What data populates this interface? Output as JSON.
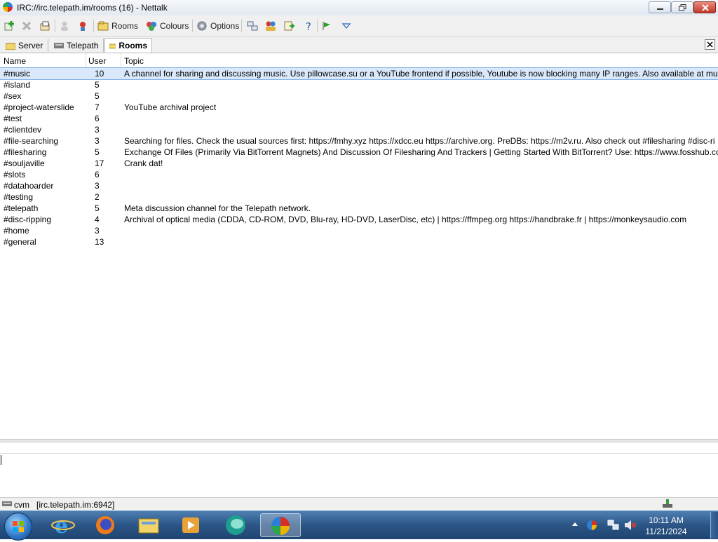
{
  "window": {
    "title": "IRC://irc.telepath.im/rooms (16)  -  Nettalk"
  },
  "toolbar": {
    "rooms_label": "Rooms",
    "colours_label": "Colours",
    "options_label": "Options"
  },
  "tabs": [
    {
      "label": "Server",
      "active": false
    },
    {
      "label": "Telepath",
      "active": false
    },
    {
      "label": "Rooms",
      "active": true
    }
  ],
  "list": {
    "columns": {
      "name": "Name",
      "user": "User",
      "topic": "Topic"
    },
    "rows": [
      {
        "name": "#music",
        "user": "10",
        "topic": "A channel for sharing and discussing music. Use pillowcase.su or a YouTube frontend if possible, Youtube is now blocking many IP ranges. Also available at mus",
        "selected": true
      },
      {
        "name": "#island",
        "user": "5",
        "topic": ""
      },
      {
        "name": "#sex",
        "user": "5",
        "topic": ""
      },
      {
        "name": "#project-waterslide",
        "user": "7",
        "topic": "YouTube archival project"
      },
      {
        "name": "#test",
        "user": "6",
        "topic": ""
      },
      {
        "name": "#clientdev",
        "user": "3",
        "topic": ""
      },
      {
        "name": "#file-searching",
        "user": "3",
        "topic": "Searching for files. Check the usual sources first: https://fmhy.xyz https://xdcc.eu https://archive.org. PreDBs: https://m2v.ru. Also check out #filesharing #disc-ri"
      },
      {
        "name": "#filesharing",
        "user": "5",
        "topic": "Exchange Of Files (Primarily Via BitTorrent Magnets) And Discussion Of Filesharing And Trackers | Getting Started With BitTorrent? Use: https://www.fosshub.con"
      },
      {
        "name": "#souljaville",
        "user": "17",
        "topic": "Crank dat!"
      },
      {
        "name": "#slots",
        "user": "6",
        "topic": ""
      },
      {
        "name": "#datahoarder",
        "user": "3",
        "topic": ""
      },
      {
        "name": "#testing",
        "user": "2",
        "topic": ""
      },
      {
        "name": "#telepath",
        "user": "5",
        "topic": "Meta discussion channel for the Telepath network."
      },
      {
        "name": "#disc-ripping",
        "user": "4",
        "topic": "Archival of optical media (CDDA, CD-ROM, DVD, Blu-ray, HD-DVD, LaserDisc, etc) | https://ffmpeg.org https://handbrake.fr | https://monkeysaudio.com"
      },
      {
        "name": "#home",
        "user": "3",
        "topic": ""
      },
      {
        "name": "#general",
        "user": "13",
        "topic": ""
      }
    ]
  },
  "input": {
    "value": ""
  },
  "statusbar": {
    "nick": "cvm",
    "server": "[irc.telepath.im:6942]"
  },
  "taskbar": {
    "time": "10:11 AM",
    "date": "11/21/2024"
  },
  "colors": {
    "selected_row": "#d9e9fb",
    "taskbar": "#2b5586"
  }
}
